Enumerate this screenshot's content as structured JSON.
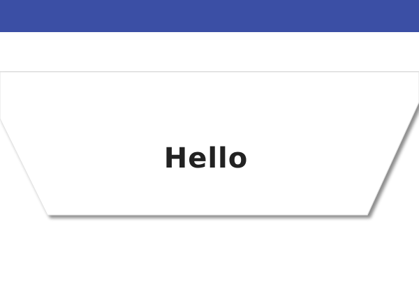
{
  "header": {
    "bar_color": "#3b4fa5"
  },
  "card": {
    "text": "Hello",
    "background": "#ffffff",
    "shadow_color": "#9e9e9e"
  }
}
